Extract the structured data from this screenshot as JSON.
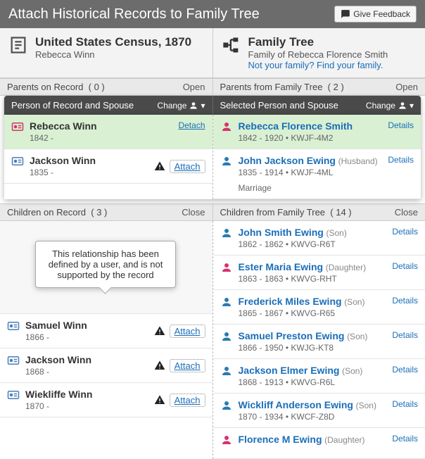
{
  "topbar": {
    "title": "Attach Historical Records to Family Tree",
    "feedback": "Give Feedback"
  },
  "record_header": {
    "title": "United States Census, 1870",
    "subtitle": "Rebecca Winn"
  },
  "tree_header": {
    "title": "Family Tree",
    "subtitle": "Family of Rebecca Florence Smith",
    "link": "Not your family? Find your family."
  },
  "parents_row": {
    "left_label": "Parents on Record",
    "left_count": "( 0 )",
    "left_toggle": "Open",
    "right_label": "Parents from Family Tree",
    "right_count": "( 2 )",
    "right_toggle": "Open"
  },
  "spouse_hdr": {
    "left": "Person of Record and Spouse",
    "right": "Selected Person and Spouse",
    "change": "Change"
  },
  "record_person": {
    "name": "Rebecca Winn",
    "meta": "1842 -",
    "action": "Detach"
  },
  "record_spouse": {
    "name": "Jackson Winn",
    "meta": "1835 -",
    "action": "Attach"
  },
  "tree_person": {
    "name": "Rebecca Florence Smith",
    "meta": "1842 - 1920 • KWJF-4M2",
    "details": "Details"
  },
  "tree_spouse": {
    "name": "John Jackson Ewing",
    "rel": "(Husband)",
    "meta": "1835 - 1914 • KWJF-4ML",
    "marriage": "Marriage",
    "details": "Details"
  },
  "children_hdr": {
    "left_label": "Children on Record",
    "left_count": "( 3 )",
    "left_toggle": "Close",
    "right_label": "Children from Family Tree",
    "right_count": "( 14 )",
    "right_toggle": "Close"
  },
  "tooltip": "This relationship has been defined by a user, and is not supported by the record",
  "record_children": [
    {
      "name": "Samuel Winn",
      "meta": "1866 -",
      "action": "Attach"
    },
    {
      "name": "Jackson Winn",
      "meta": "1868 -",
      "action": "Attach"
    },
    {
      "name": "Wiekliffe Winn",
      "meta": "1870 -",
      "action": "Attach"
    }
  ],
  "tree_children": [
    {
      "name": "John Smith Ewing",
      "rel": "(Son)",
      "meta": "1862 - 1862 • KWVG-R6T",
      "gender": "m"
    },
    {
      "name": "Ester Maria Ewing",
      "rel": "(Daughter)",
      "meta": "1863 - 1863 • KWVG-RHT",
      "gender": "f"
    },
    {
      "name": "Frederick Miles Ewing",
      "rel": "(Son)",
      "meta": "1865 - 1867 • KWVG-R65",
      "gender": "m"
    },
    {
      "name": "Samuel Preston Ewing",
      "rel": "(Son)",
      "meta": "1866 - 1950 • KWJG-KT8",
      "gender": "m"
    },
    {
      "name": "Jackson Elmer Ewing",
      "rel": "(Son)",
      "meta": "1868 - 1913 • KWVG-R6L",
      "gender": "m"
    },
    {
      "name": "Wickliff Anderson Ewing",
      "rel": "(Son)",
      "meta": "1870 - 1934 • KWCF-Z8D",
      "gender": "m"
    },
    {
      "name": "Florence M Ewing",
      "rel": "(Daughter)",
      "meta": "",
      "gender": "f"
    }
  ],
  "details_label": "Details",
  "colors": {
    "link": "#1a6eb8",
    "pink": "#d6336c",
    "blue": "#2a7ab0"
  }
}
